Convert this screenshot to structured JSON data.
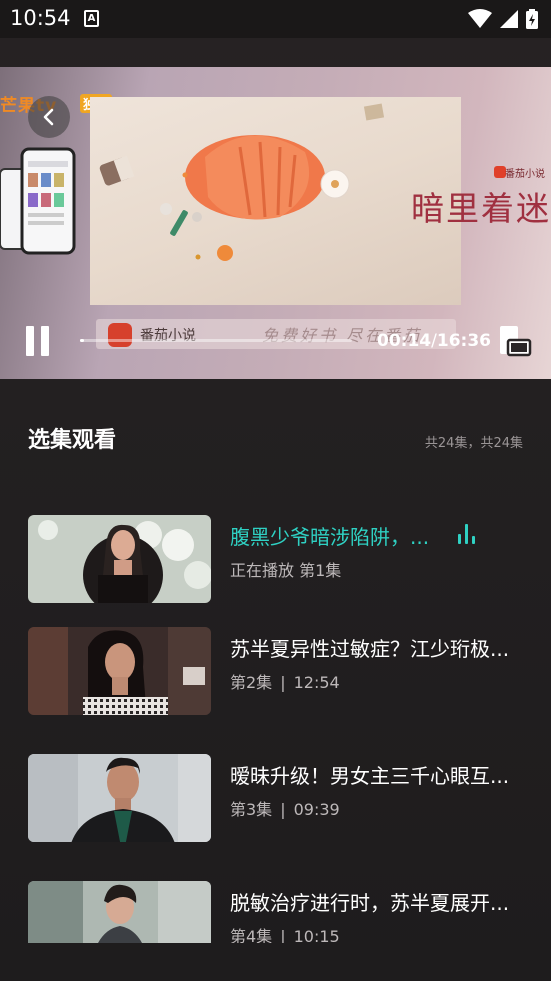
{
  "status_bar": {
    "time": "10:54",
    "notification_icon": "a-icon",
    "icons": [
      "wifi-icon",
      "signal-icon",
      "battery-charging-icon"
    ]
  },
  "video": {
    "brand": "芒果tv",
    "brand_badge": "独播",
    "banner_text": "番茄小说",
    "banner_slogan": "免费好书 尽在番茄",
    "side_logo_small": "番茄小说",
    "side_logo_text": "暗里着迷",
    "current_time": "00:14",
    "separator": "/",
    "duration": "16:36",
    "progress": 0.014,
    "colors": {
      "accent": "#2fd1c3"
    }
  },
  "episodes": {
    "title": "选集观看",
    "count_text": "共24集，共24集",
    "items": [
      {
        "title": "腹黑少爷暗涉陷阱，...",
        "meta": "正在播放 第1集",
        "active": true
      },
      {
        "title": "苏半夏异性过敏症？江少珩极...",
        "episode": "第2集",
        "duration": "12:54"
      },
      {
        "title": "暧昧升级！男女主三千心眼互...",
        "episode": "第3集",
        "duration": "09:39"
      },
      {
        "title": "脱敏治疗进行时，苏半夏展开...",
        "episode": "第4集",
        "duration": "10:15"
      }
    ]
  }
}
